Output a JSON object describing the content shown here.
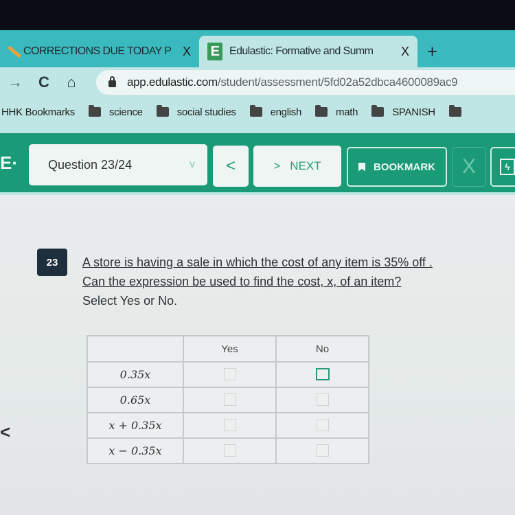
{
  "browser": {
    "tabs": [
      {
        "title": "CORRECTIONS DUE TODAY P",
        "icon": "pencil-icon",
        "active": false
      },
      {
        "title": "Edulastic: Formative and Summ",
        "icon": "edulastic-icon",
        "icon_glyph": "E",
        "active": true
      }
    ],
    "tab_close_glyph": "X",
    "new_tab_glyph": "+",
    "nav": {
      "forward": "→",
      "reload": "C",
      "home": "⌂"
    },
    "url": {
      "host": "app.edulastic.com",
      "path": "/student/assessment/5fd02a52dbca4600089ac9"
    },
    "bookmarks": [
      {
        "label": "HHK Bookmarks",
        "folder": false
      },
      {
        "label": "science",
        "folder": true
      },
      {
        "label": "social studies",
        "folder": true
      },
      {
        "label": "english",
        "folder": true
      },
      {
        "label": "math",
        "folder": true
      },
      {
        "label": "SPANISH",
        "folder": true
      },
      {
        "label": "",
        "folder": true
      }
    ]
  },
  "app": {
    "logo": "E·",
    "question_selector": "Question 23/24",
    "chevron": "v",
    "prev_glyph": "<",
    "next_glyph": ">",
    "next_label": "NEXT",
    "bookmark_label": "BOOKMARK",
    "close_glyph": "X",
    "tools_glyph": "ϟ",
    "accent_color": "#1a9a76"
  },
  "question": {
    "number": "23",
    "line1": "A store is having a sale in which the cost of any item is 35% off .",
    "line2": "Can the expression be used to find the cost, x, of an item?",
    "line3": "Select Yes or No.",
    "columns": [
      "",
      "Yes",
      "No"
    ],
    "rows": [
      {
        "expression": "0.35x",
        "yes": false,
        "no": false,
        "focused": "no"
      },
      {
        "expression": "0.65x",
        "yes": false,
        "no": false
      },
      {
        "expression": "x + 0.35x",
        "yes": false,
        "no": false
      },
      {
        "expression": "x − 0.35x",
        "yes": false,
        "no": false
      }
    ]
  },
  "side_nav_glyph": "<"
}
